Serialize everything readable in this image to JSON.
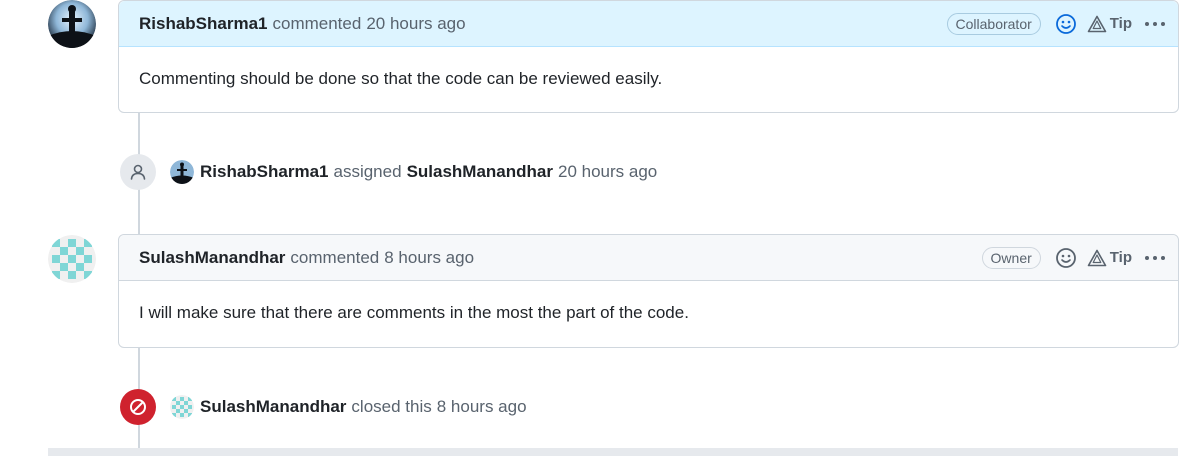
{
  "comments": [
    {
      "author": "RishabSharma1",
      "action": "commented",
      "time": "20 hours ago",
      "role": "Collaborator",
      "tip_label": "Tip",
      "body": "Commenting should be done so that the code can be reviewed easily."
    },
    {
      "author": "SulashManandhar",
      "action": "commented",
      "time": "8 hours ago",
      "role": "Owner",
      "tip_label": "Tip",
      "body": "I will make sure that there are comments in the most the part of the code."
    }
  ],
  "events": [
    {
      "icon": "person-icon",
      "actor": "RishabSharma1",
      "action": "assigned",
      "target": "SulashManandhar",
      "time": "20 hours ago"
    },
    {
      "icon": "closed-circle-slash-icon",
      "actor": "SulashManandhar",
      "action": "closed this",
      "time": "8 hours ago"
    }
  ],
  "colors": {
    "highlight_header": "#ddf4ff",
    "closed_red": "#cf222e",
    "border": "#d0d7de"
  }
}
